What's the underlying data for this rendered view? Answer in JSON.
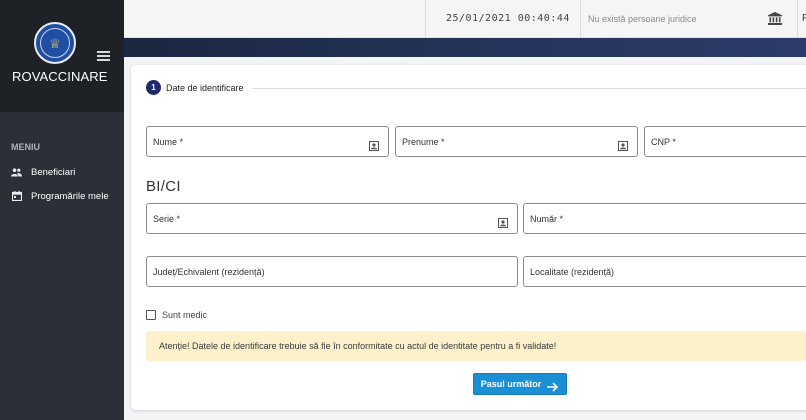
{
  "app": {
    "name": "ROVACCINARE"
  },
  "sidebar": {
    "menu_title": "MENIU",
    "items": [
      {
        "label": "Beneficiari",
        "icon": "people-icon"
      },
      {
        "label": "Programările mele",
        "icon": "calendar-icon"
      }
    ]
  },
  "header": {
    "datetime": "25/01/2021 00:40:44",
    "entity_placeholder": "Nu există persoane juridice",
    "cut_text": "F"
  },
  "form": {
    "step_number": "1",
    "step_title": "Date de identificare",
    "fields": {
      "nume": "Nume *",
      "prenume": "Prenume *",
      "cnp": "CNP *",
      "serie": "Serie *",
      "numar": "Număr *",
      "judet": "Județ/Echivalent (rezidență)",
      "localitate": "Localitate (rezidență)"
    },
    "section_title": "BI/CI",
    "checkbox_label": "Sunt medic",
    "alert": "Atenție! Datele de identificare trebuie să fie în conformitate cu actul de identitate pentru a fi validate!",
    "next_button": "Pasul următor"
  },
  "colors": {
    "sidebar": "#2b2f36",
    "step_circle": "#1d2b6b",
    "primary_button": "#1b8fd4",
    "alert_bg": "#fdf1cc"
  }
}
